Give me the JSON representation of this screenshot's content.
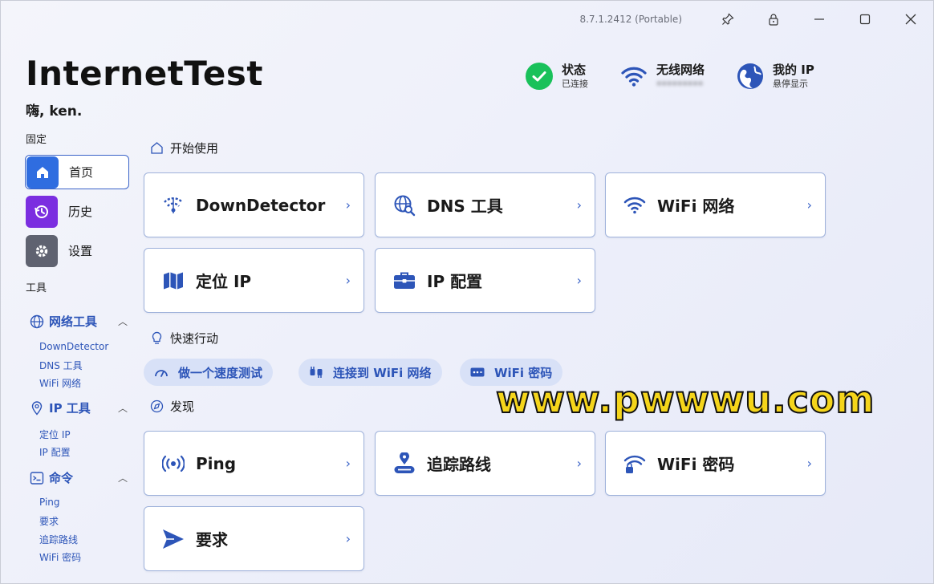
{
  "window": {
    "version": "8.7.1.2412 (Portable)"
  },
  "header": {
    "title": "InternetTest",
    "greeting": "嗨, ken.",
    "status": {
      "label": "状态",
      "value": "已连接"
    },
    "wifi": {
      "label": "无线网络",
      "value": "•••••••••"
    },
    "ip": {
      "label": "我的 IP",
      "value": "悬停显示"
    }
  },
  "sidebar": {
    "pinned_label": "固定",
    "nav": [
      {
        "label": "首页",
        "icon": "home-icon"
      },
      {
        "label": "历史",
        "icon": "history-icon"
      },
      {
        "label": "设置",
        "icon": "gear-icon"
      }
    ],
    "tools_label": "工具",
    "groups": [
      {
        "label": "网络工具",
        "icon": "globe-icon",
        "items": [
          "DownDetector",
          "DNS 工具",
          "WiFi 网络"
        ]
      },
      {
        "label": "IP 工具",
        "icon": "location-pin-icon",
        "items": [
          "定位 IP",
          "IP 配置"
        ]
      },
      {
        "label": "命令",
        "icon": "command-icon",
        "items": [
          "Ping",
          "要求",
          "追踪路线",
          "WiFi 密码"
        ]
      }
    ]
  },
  "main": {
    "get_started": {
      "title": "开始使用",
      "cards": [
        {
          "label": "DownDetector",
          "icon": "down-detector-icon"
        },
        {
          "label": "DNS 工具",
          "icon": "dns-search-icon"
        },
        {
          "label": "WiFi 网络",
          "icon": "wifi-icon"
        },
        {
          "label": "定位 IP",
          "icon": "map-icon"
        },
        {
          "label": "IP 配置",
          "icon": "toolbox-icon"
        }
      ]
    },
    "quick_actions": {
      "title": "快速行动",
      "pills": [
        {
          "label": "做一个速度测试",
          "icon": "speedometer-icon"
        },
        {
          "label": "连接到 WiFi 网络",
          "icon": "plug-icon"
        },
        {
          "label": "WiFi 密码",
          "icon": "password-icon"
        }
      ]
    },
    "discover": {
      "title": "发现",
      "cards": [
        {
          "label": "Ping",
          "icon": "ping-icon"
        },
        {
          "label": "追踪路线",
          "icon": "route-icon"
        },
        {
          "label": "WiFi 密码",
          "icon": "wifi-lock-icon"
        },
        {
          "label": "要求",
          "icon": "send-icon"
        }
      ]
    }
  },
  "watermark": "www.pwwwu.com",
  "colors": {
    "accent": "#2d55b8",
    "home_tile": "#2f6de0",
    "history_tile": "#7b2ee0",
    "settings_tile": "#5f6270",
    "connected": "#19c15a"
  }
}
